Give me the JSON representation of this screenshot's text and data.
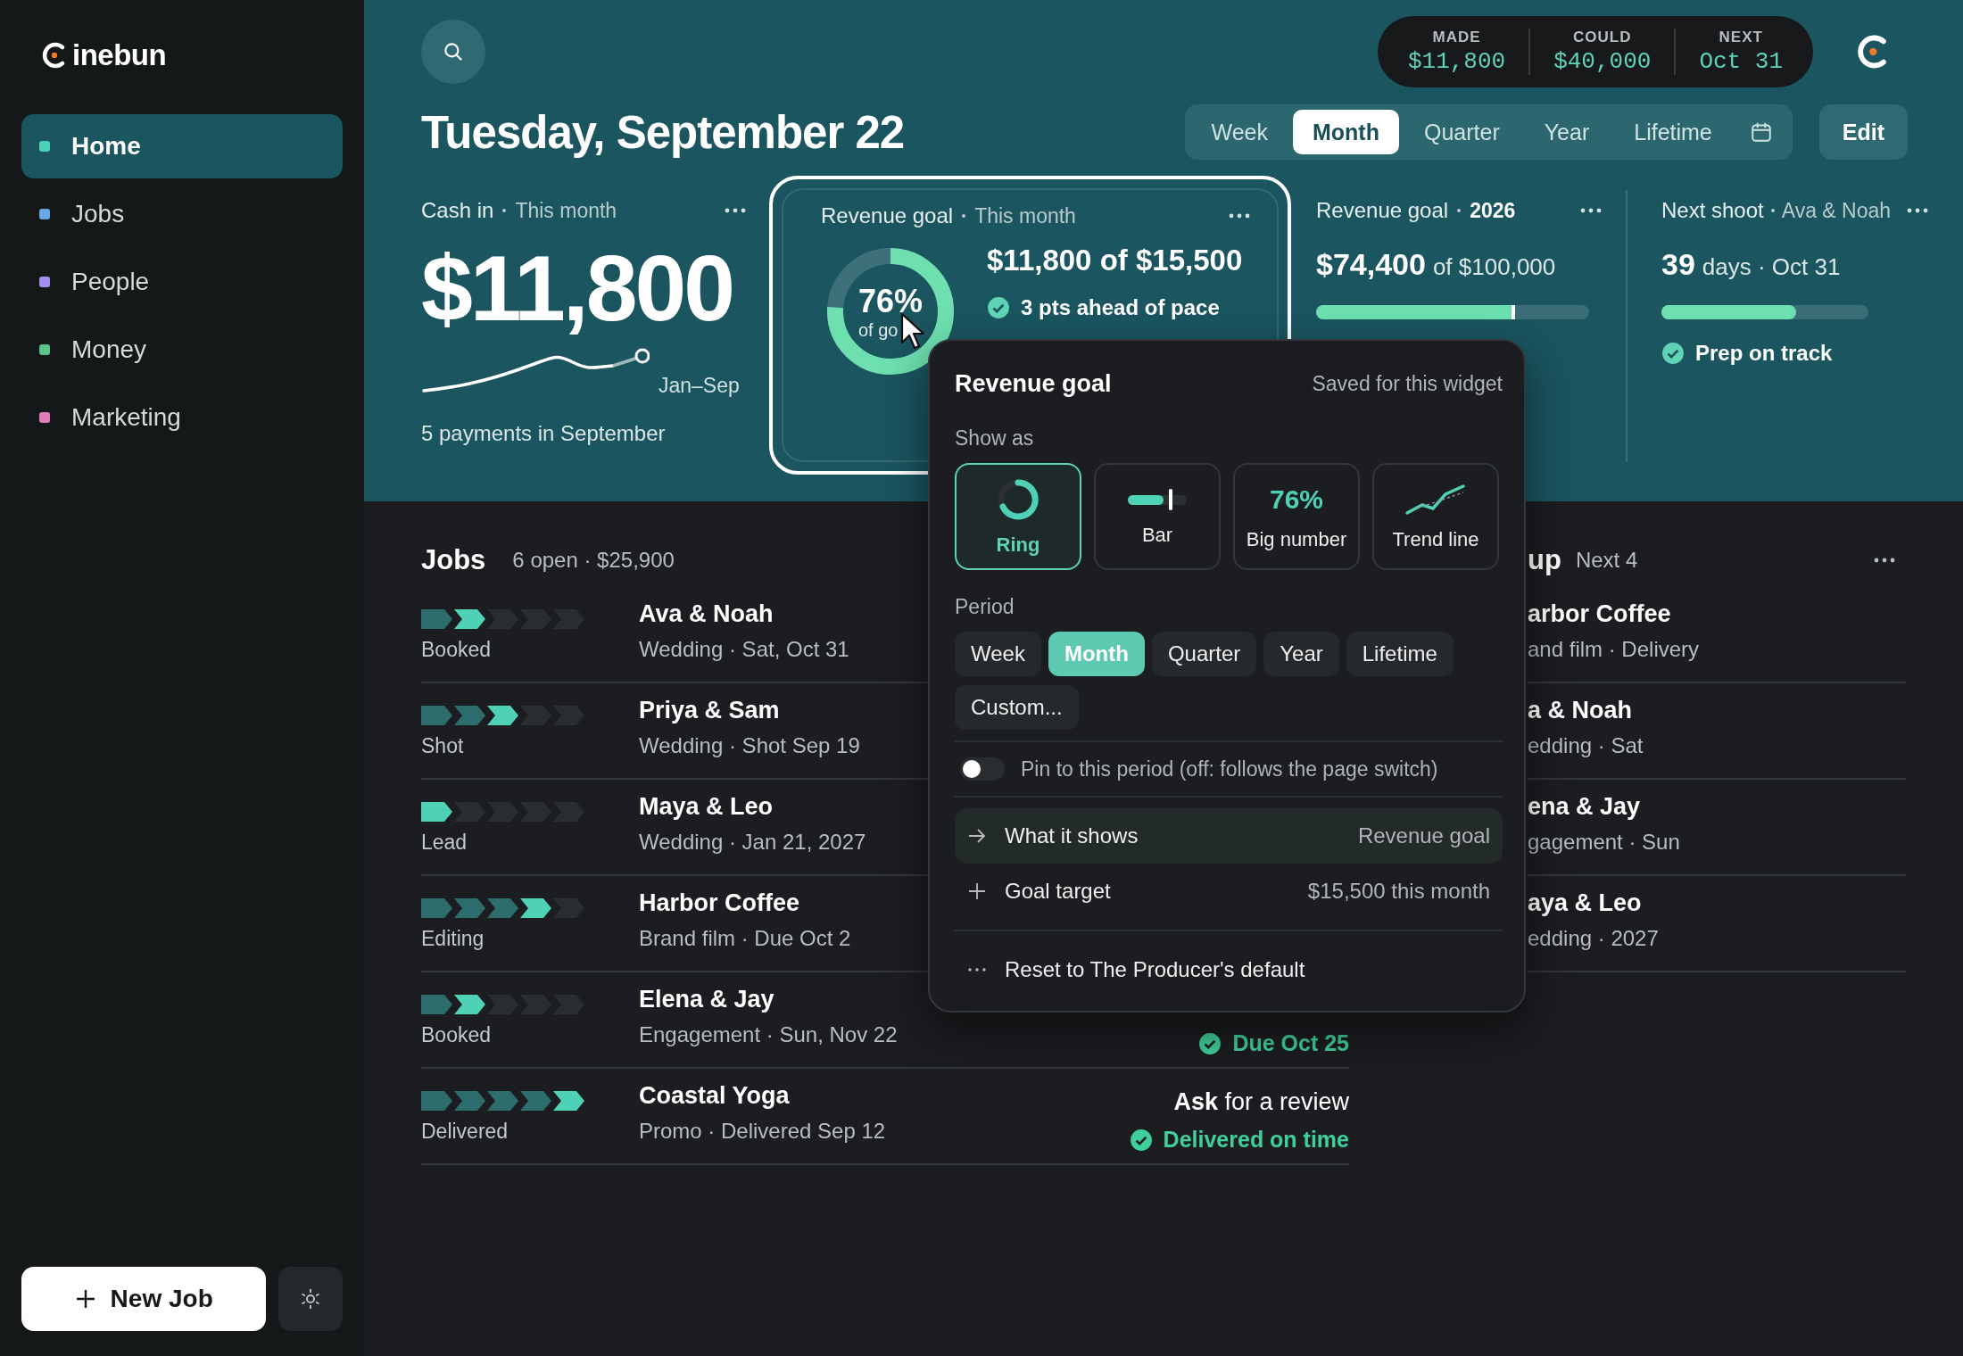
{
  "brand": {
    "name": "inebun"
  },
  "nav": [
    {
      "label": "Home",
      "selected": true,
      "color": "#4fd1b5"
    },
    {
      "label": "Jobs",
      "selected": false,
      "color": "#6aa6e8"
    },
    {
      "label": "People",
      "selected": false,
      "color": "#a38ff0"
    },
    {
      "label": "Money",
      "selected": false,
      "color": "#5cc48a"
    },
    {
      "label": "Marketing",
      "selected": false,
      "color": "#e27bb6"
    }
  ],
  "new_job_button": {
    "label": "New Job"
  },
  "header": {
    "title": "Tuesday, September 22",
    "stats": [
      {
        "label": "MADE",
        "value": "$11,800"
      },
      {
        "label": "COULD",
        "value": "$40,000"
      },
      {
        "label": "NEXT",
        "value": "Oct 31"
      }
    ],
    "periods": [
      {
        "label": "Week",
        "selected": false
      },
      {
        "label": "Month",
        "selected": true
      },
      {
        "label": "Quarter",
        "selected": false
      },
      {
        "label": "Year",
        "selected": false
      },
      {
        "label": "Lifetime",
        "selected": false
      }
    ],
    "edit_button": "Edit"
  },
  "cash_in": {
    "title": "Cash in",
    "period": "This month",
    "amount": "$11,800",
    "range": "Jan–Sep",
    "footnote": "5 payments in September"
  },
  "revenue_goal": {
    "title": "Revenue goal",
    "period": "This month",
    "selected": true,
    "level": 0.76,
    "percent": "76%",
    "caption": "of go",
    "amount": "$11,800 of $15,500",
    "pace": "3 pts ahead of pace"
  },
  "revenue_goal_year": {
    "title": "Revenue goal",
    "period": "2026",
    "amount": "$74,400",
    "target": "of $100,000",
    "level": 0.73
  },
  "next_shoot": {
    "title": "Next shoot",
    "subject": "Ava & Noah",
    "count": "39",
    "unit": "days · Oct 31",
    "level": 0.65,
    "status": "Prep on track"
  },
  "jobs": {
    "title": "Jobs",
    "summary": "6 open · $25,900",
    "rows": [
      {
        "steps": [
          {
            "selected": false
          },
          {
            "selected": true
          },
          {
            "selected": false
          },
          {
            "selected": false
          },
          {
            "selected": false
          }
        ],
        "status": "Booked",
        "name": "Ava & Noah",
        "detail": "Wedding · Sat, Oct 31"
      },
      {
        "steps": [
          {
            "selected": false
          },
          {
            "selected": false
          },
          {
            "selected": true
          },
          {
            "selected": false
          },
          {
            "selected": false
          }
        ],
        "status": "Shot",
        "name": "Priya & Sam",
        "detail": "Wedding · Shot Sep 19"
      },
      {
        "steps": [
          {
            "selected": true
          },
          {
            "selected": false
          },
          {
            "selected": false
          },
          {
            "selected": false
          },
          {
            "selected": false
          }
        ],
        "status": "Lead",
        "name": "Maya & Leo",
        "detail": "Wedding · Jan 21, 2027"
      },
      {
        "steps": [
          {
            "selected": false
          },
          {
            "selected": false
          },
          {
            "selected": false
          },
          {
            "selected": true
          },
          {
            "selected": false
          }
        ],
        "status": "Editing",
        "name": "Harbor Coffee",
        "detail": "Brand film · Due Oct 2"
      },
      {
        "steps": [
          {
            "selected": false
          },
          {
            "selected": true
          },
          {
            "selected": false
          },
          {
            "selected": false
          },
          {
            "selected": false
          }
        ],
        "status": "Booked",
        "name": "Elena & Jay",
        "detail": "Engagement · Sun, Nov 22",
        "note": "Due Oct 25"
      },
      {
        "steps": [
          {
            "selected": false
          },
          {
            "selected": false
          },
          {
            "selected": false
          },
          {
            "selected": false
          },
          {
            "selected": true
          }
        ],
        "status": "Delivered",
        "name": "Coastal Yoga",
        "detail": "Promo · Delivered Sep 12",
        "action": "**Ask** for a review",
        "note": "Delivered on time"
      }
    ]
  },
  "up_next": {
    "title": "up",
    "subtitle": "Next 4",
    "rows": [
      {
        "name": "arbor Coffee",
        "detail": "and film · Delivery"
      },
      {
        "name": "a & Noah",
        "detail": "edding · Sat"
      },
      {
        "name": "ena & Jay",
        "detail": "gagement · Sun"
      },
      {
        "name": "aya & Leo",
        "detail": "edding · 2027"
      }
    ]
  },
  "popover": {
    "title": "Revenue goal",
    "note": "Saved for this widget",
    "show_as_label": "Show as",
    "options": [
      {
        "kind": "ring",
        "label": "Ring",
        "selected": true
      },
      {
        "kind": "bar",
        "label": "Bar",
        "selected": false
      },
      {
        "kind": "big_number",
        "label": "Big number",
        "preview": "76%",
        "selected": false
      },
      {
        "kind": "trend",
        "label": "Trend line",
        "selected": false
      }
    ],
    "period_label": "Period",
    "periods": [
      {
        "label": "Week",
        "selected": false
      },
      {
        "label": "Month",
        "selected": true
      },
      {
        "label": "Quarter",
        "selected": false
      },
      {
        "label": "Year",
        "selected": false
      },
      {
        "label": "Lifetime",
        "selected": false
      },
      {
        "label": "Custom...",
        "selected": false
      }
    ],
    "pin": {
      "label": "Pin to this period (off: follows the page switch)",
      "on": false
    },
    "rows": [
      {
        "kind": "arrow",
        "label": "What it shows",
        "value": "Revenue goal",
        "selected": true
      },
      {
        "kind": "plus",
        "label": "Goal target",
        "value": "$15,500 this month",
        "selected": false
      }
    ],
    "reset": "Reset to The Producer's default"
  }
}
